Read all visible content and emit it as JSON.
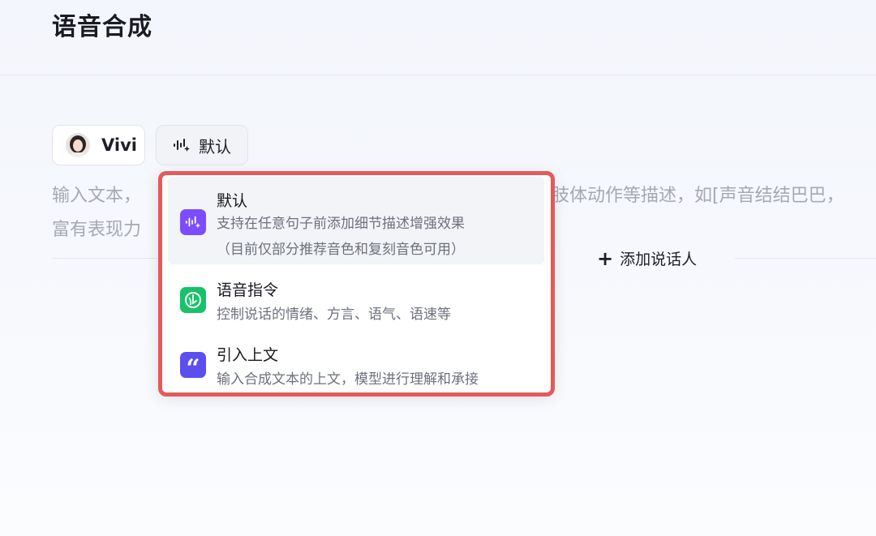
{
  "header": {
    "title": "语音合成"
  },
  "toolbar": {
    "voice_chip": {
      "label": "Vivi"
    },
    "mode_chip": {
      "label": "默认"
    }
  },
  "editor": {
    "placeholder_part1": "输入文本，",
    "placeholder_part2": "肢体动作等描述，如[声音结结巴巴，",
    "placeholder_line2": "富有表现力"
  },
  "add_speaker": {
    "label": "添加说话人"
  },
  "dropdown": {
    "items": [
      {
        "title": "默认",
        "desc_line1": "支持在任意句子前添加细节描述增强效果",
        "desc_line2": "（目前仅部分推荐音色和复刻音色可用）",
        "icon": "sound-wave-icon",
        "color": "#7c4dff"
      },
      {
        "title": "语音指令",
        "desc_line1": "控制说话的情绪、方言、语气、语速等",
        "icon": "voice-command-icon",
        "color": "#16c26a"
      },
      {
        "title": "引入上文",
        "desc_line1": "输入合成文本的上文，模型进行理解和承接",
        "icon": "quote-icon",
        "color": "#5b4ff0"
      }
    ]
  },
  "colors": {
    "highlight_border": "#e45a59"
  }
}
